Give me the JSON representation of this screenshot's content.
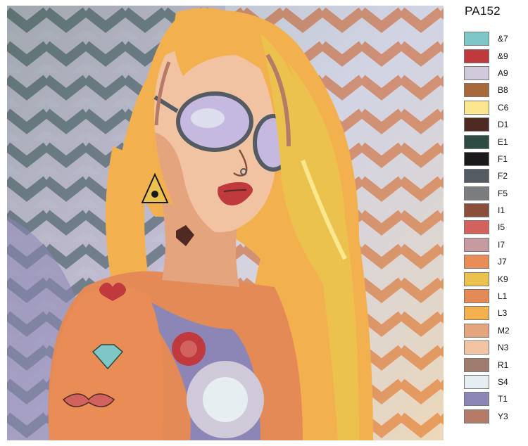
{
  "product_code": "PA152",
  "palette": [
    {
      "code": "&7",
      "color": "#7fc6c6"
    },
    {
      "code": "&9",
      "color": "#c0393c"
    },
    {
      "code": "A9",
      "color": "#d0c9d9"
    },
    {
      "code": "B8",
      "color": "#a8683a"
    },
    {
      "code": "C6",
      "color": "#fbe88e"
    },
    {
      "code": "D1",
      "color": "#4e2a22"
    },
    {
      "code": "E1",
      "color": "#2d4a43"
    },
    {
      "code": "F1",
      "color": "#1a1a1c"
    },
    {
      "code": "F2",
      "color": "#555b62"
    },
    {
      "code": "F5",
      "color": "#7a7c80"
    },
    {
      "code": "I1",
      "color": "#8a4e3a"
    },
    {
      "code": "I5",
      "color": "#d2625e"
    },
    {
      "code": "I7",
      "color": "#c69aa0"
    },
    {
      "code": "J7",
      "color": "#ea8c55"
    },
    {
      "code": "K9",
      "color": "#ebc24e"
    },
    {
      "code": "L1",
      "color": "#e38a56"
    },
    {
      "code": "L3",
      "color": "#f3b04e"
    },
    {
      "code": "M2",
      "color": "#e4a57e"
    },
    {
      "code": "N3",
      "color": "#f1c3a3"
    },
    {
      "code": "R1",
      "color": "#9f7c6d"
    },
    {
      "code": "S4",
      "color": "#e6eef2"
    },
    {
      "code": "T1",
      "color": "#8c86b7"
    },
    {
      "code": "Y3",
      "color": "#b67a68"
    }
  ]
}
